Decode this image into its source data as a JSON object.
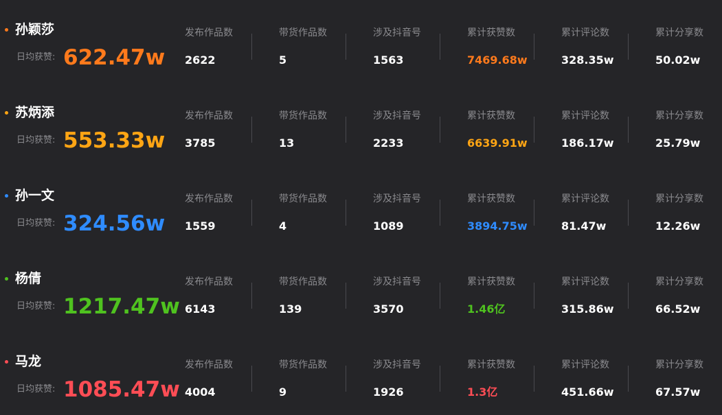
{
  "labels": {
    "daily_likes": "日均获赞:",
    "stats": [
      "发布作品数",
      "带货作品数",
      "涉及抖音号",
      "累计获赞数",
      "累计评论数",
      "累计分享数"
    ]
  },
  "people": [
    {
      "name": "孙颖莎",
      "color": "#ff7a1c",
      "daily_likes": "622.47w",
      "stats": [
        "2622",
        "5",
        "1563",
        "7469.68w",
        "328.35w",
        "50.02w"
      ]
    },
    {
      "name": "苏炳添",
      "color": "#ffa514",
      "daily_likes": "553.33w",
      "stats": [
        "3785",
        "13",
        "2233",
        "6639.91w",
        "186.17w",
        "25.79w"
      ]
    },
    {
      "name": "孙一文",
      "color": "#2f8cff",
      "daily_likes": "324.56w",
      "stats": [
        "1559",
        "4",
        "1089",
        "3894.75w",
        "81.47w",
        "12.26w"
      ]
    },
    {
      "name": "杨倩",
      "color": "#4fc21f",
      "daily_likes": "1217.47w",
      "stats": [
        "6143",
        "139",
        "3570",
        "1.46亿",
        "315.86w",
        "66.52w"
      ]
    },
    {
      "name": "马龙",
      "color": "#ff4d55",
      "daily_likes": "1085.47w",
      "stats": [
        "4004",
        "9",
        "1926",
        "1.3亿",
        "451.66w",
        "67.57w"
      ]
    }
  ]
}
